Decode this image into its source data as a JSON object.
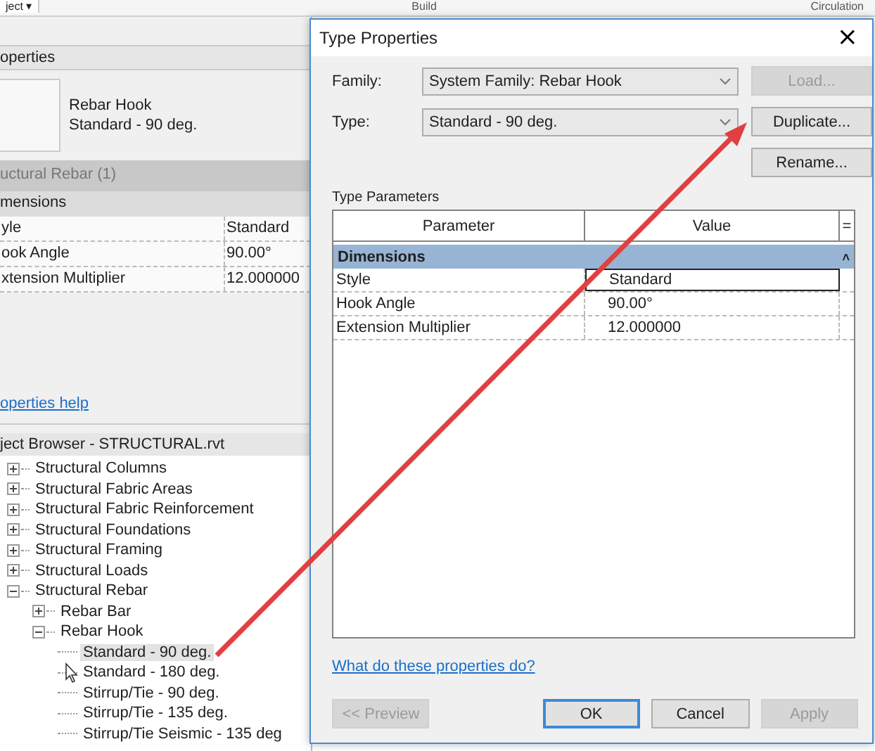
{
  "ribbon": {
    "tab_menu": "ject ▾",
    "labels": [
      "Build",
      "Circulation"
    ]
  },
  "properties": {
    "title": "operties",
    "type_name": "Rebar Hook",
    "type_value": "Standard - 90 deg.",
    "filter": "uctural Rebar (1)",
    "group": "mensions",
    "rows": [
      {
        "name": "yle",
        "value": "Standard"
      },
      {
        "name": "ook Angle",
        "value": "90.00°"
      },
      {
        "name": "xtension Multiplier",
        "value": "12.000000"
      }
    ],
    "help_link": "operties help"
  },
  "project_browser": {
    "title": "ject Browser - STRUCTURAL.rvt",
    "items": [
      {
        "label": "Structural Columns",
        "expanded": false
      },
      {
        "label": "Structural Fabric Areas",
        "expanded": false
      },
      {
        "label": "Structural Fabric Reinforcement",
        "expanded": false
      },
      {
        "label": "Structural Foundations",
        "expanded": false
      },
      {
        "label": "Structural Framing",
        "expanded": false
      },
      {
        "label": "Structural Loads",
        "expanded": false
      },
      {
        "label": "Structural Rebar",
        "expanded": true,
        "children": [
          {
            "label": "Rebar Bar",
            "expanded": false
          },
          {
            "label": "Rebar Hook",
            "expanded": true,
            "children": [
              {
                "label": "Standard - 90 deg.",
                "selected": true
              },
              {
                "label": "Standard - 180 deg.",
                "selected": false
              },
              {
                "label": "Stirrup/Tie - 90 deg.",
                "selected": false
              },
              {
                "label": "Stirrup/Tie - 135 deg.",
                "selected": false
              },
              {
                "label": "Stirrup/Tie Seismic - 135 deg",
                "selected": false
              }
            ]
          }
        ]
      }
    ]
  },
  "dialog": {
    "title": "Type Properties",
    "close": "×",
    "family": {
      "label": "Family:",
      "value": "System Family: Rebar Hook"
    },
    "type": {
      "label": "Type:",
      "value": "Standard - 90 deg."
    },
    "side_buttons": [
      {
        "label": "Load...",
        "disabled": true
      },
      {
        "label": "Duplicate...",
        "disabled": false
      },
      {
        "label": "Rename...",
        "disabled": false
      }
    ],
    "section_title": "Type Parameters",
    "table": {
      "columns": [
        "Parameter",
        "Value",
        "="
      ],
      "group": "Dimensions",
      "collapse": "˄",
      "rows": [
        {
          "parameter": "Style",
          "value": "Standard",
          "editing": true
        },
        {
          "parameter": "Hook Angle",
          "value": "90.00°",
          "editing": false
        },
        {
          "parameter": "Extension Multiplier",
          "value": "12.000000",
          "editing": false
        }
      ]
    },
    "help_link": "What do these properties do?",
    "buttons": [
      {
        "label": "<< Preview",
        "disabled": true,
        "default": false
      },
      {
        "label": "OK",
        "disabled": false,
        "default": true
      },
      {
        "label": "Cancel",
        "disabled": false,
        "default": false
      },
      {
        "label": "Apply",
        "disabled": true,
        "default": false
      }
    ]
  }
}
